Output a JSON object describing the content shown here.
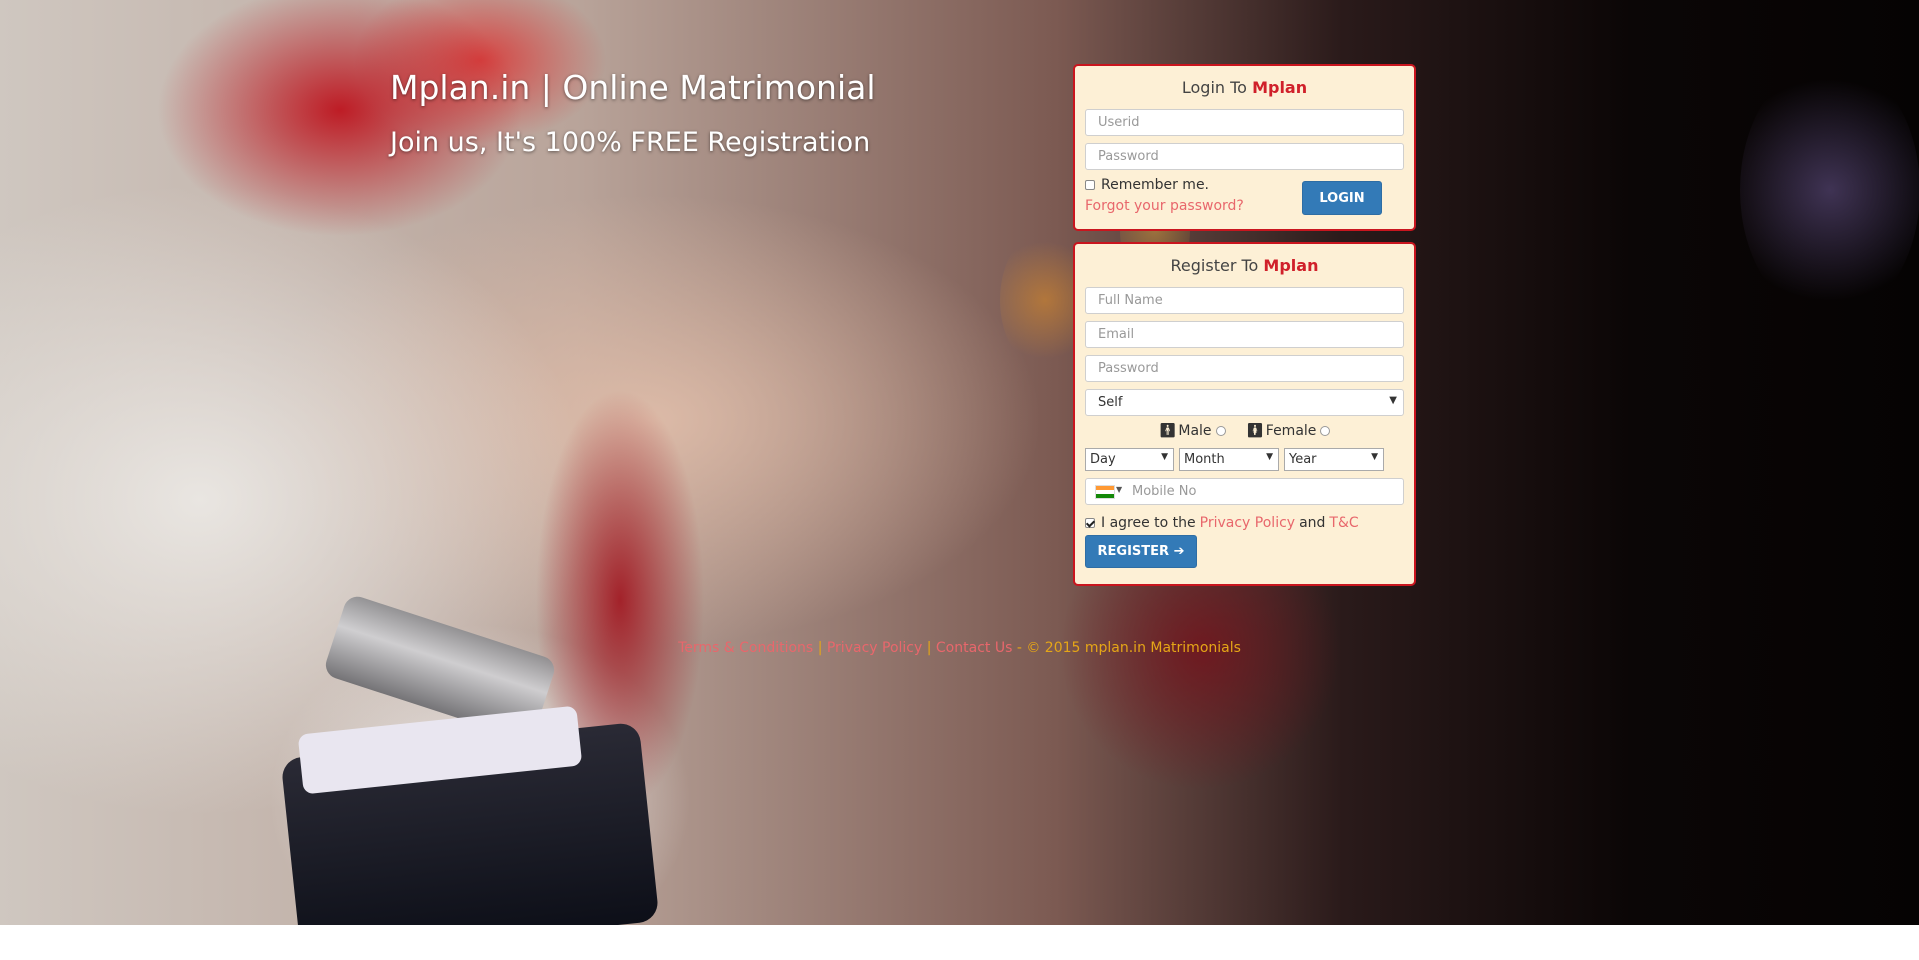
{
  "hero": {
    "title": "Mplan.in | Online Matrimonial",
    "subtitle": "Join us, It's 100% FREE Registration"
  },
  "login": {
    "title_prefix": "Login To",
    "brand": "Mplan",
    "userid_placeholder": "Userid",
    "password_placeholder": "Password",
    "remember_label": "Remember me.",
    "forgot_link": "Forgot your password?",
    "login_button": "LOGIN"
  },
  "register": {
    "title_prefix": "Register To",
    "brand": "Mplan",
    "fullname_placeholder": "Full Name",
    "email_placeholder": "Email",
    "password_placeholder": "Password",
    "profile_for": "Self",
    "gender_male": "Male",
    "gender_female": "Female",
    "dob_day": "Day",
    "dob_month": "Month",
    "dob_year": "Year",
    "mobile_placeholder": "Mobile No",
    "agree_prefix": "I agree to the",
    "privacy_link": "Privacy Policy",
    "and_text": "and",
    "tc_link": "T&C",
    "register_button": "REGISTER"
  },
  "footer": {
    "terms": "Terms & Conditions",
    "privacy": "Privacy Policy",
    "contact": "Contact Us",
    "copyright": " - © 2015 mplan.in Matrimonials"
  },
  "colors": {
    "brand_red": "#d0202a",
    "panel_bg": "#fdf0d6",
    "button_blue": "#337ab7",
    "link_pink": "#e8676c",
    "footer_gold": "#e5a617"
  },
  "flag_colors": [
    "#ff9933",
    "#ffffff",
    "#138808"
  ]
}
